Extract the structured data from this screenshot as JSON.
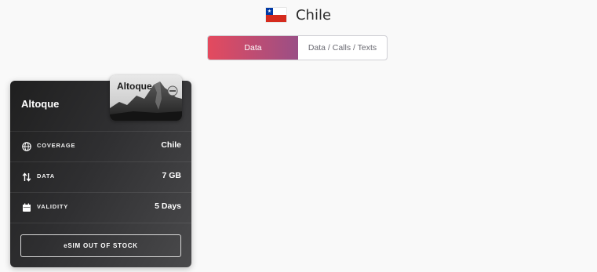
{
  "header": {
    "country": "Chile",
    "flag_icon": "chile-flag-icon"
  },
  "tabs": [
    {
      "label": "Data",
      "active": true
    },
    {
      "label": "Data / Calls / Texts",
      "active": false
    }
  ],
  "package": {
    "operator_name": "Altoque",
    "operator_logo_text": "Altoque",
    "rows": [
      {
        "icon": "globe-icon",
        "label": "COVERAGE",
        "value": "Chile"
      },
      {
        "icon": "arrows-up-down-icon",
        "label": "DATA",
        "value": "7 GB"
      },
      {
        "icon": "calendar-icon",
        "label": "VALIDITY",
        "value": "5 Days"
      }
    ],
    "button_label": "eSIM OUT OF STOCK"
  },
  "colors": {
    "active_tab_start": "#e44a5e",
    "active_tab_end": "#9a4f86",
    "card_dark": "#1f1f1f",
    "flag_red": "#d52b1e",
    "flag_blue": "#0039a6"
  }
}
